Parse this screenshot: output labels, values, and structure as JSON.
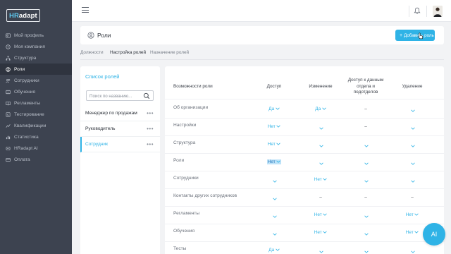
{
  "logo": {
    "text_hr": "HR",
    "text_rest": "adapt"
  },
  "sidebar": {
    "items": [
      {
        "label": "Мой профиль",
        "icon": "profile-icon"
      },
      {
        "label": "Моя компания",
        "icon": "company-icon"
      },
      {
        "label": "Структура",
        "icon": "structure-icon"
      },
      {
        "label": "Роли",
        "icon": "roles-icon",
        "active": true
      },
      {
        "label": "Сотрудники",
        "icon": "employees-icon"
      },
      {
        "label": "Обучения",
        "icon": "training-icon"
      },
      {
        "label": "Регламенты",
        "icon": "regulations-icon"
      },
      {
        "label": "Тестирование",
        "icon": "testing-icon"
      },
      {
        "label": "Квалификации",
        "icon": "qualifications-icon"
      },
      {
        "label": "Статистика",
        "icon": "statistics-icon"
      },
      {
        "label": "HRadapt AI",
        "icon": "ai-icon"
      },
      {
        "label": "Оплата",
        "icon": "payment-icon"
      }
    ]
  },
  "header": {
    "title": "Роли",
    "add_button": "Добавить роль"
  },
  "tabs": [
    {
      "label": "Должности"
    },
    {
      "label": "Настройка ролей",
      "active": true
    },
    {
      "label": "Назначение ролей"
    }
  ],
  "roles_panel": {
    "title": "Список ролей",
    "search_placeholder": "Поиск по названию...",
    "roles": [
      {
        "name": "Менеджер по продажам"
      },
      {
        "name": "Руководитель"
      },
      {
        "name": "Сотрудник",
        "selected": true
      }
    ]
  },
  "permissions": {
    "headers": {
      "capability": "Возможности роли",
      "access": "Доступ",
      "edit": "Изменение",
      "dept_access_l1": "Доступ к данным",
      "dept_access_l2": "отдела и",
      "dept_access_l3": "подотделов",
      "delete": "Удаление"
    },
    "rows": [
      {
        "label": "Об организации",
        "access": "Да",
        "edit": "Да",
        "dept": "–",
        "del": ""
      },
      {
        "label": "Настройки",
        "access": "Нет",
        "edit": "",
        "dept": "–",
        "del": ""
      },
      {
        "label": "Структура",
        "access": "Нет",
        "edit": "",
        "dept": "",
        "del": ""
      },
      {
        "label": "Роли",
        "access": "Нет",
        "edit": "",
        "dept": "",
        "del": ""
      },
      {
        "label": "Сотрудники",
        "access": "",
        "edit": "Нет",
        "dept": "",
        "del": ""
      },
      {
        "label": "Контакты других сотрудников",
        "access": "",
        "edit": "–",
        "dept": "–",
        "del": "–"
      },
      {
        "label": "Регламенты",
        "access": "",
        "edit": "Нет",
        "dept": "",
        "del": "Нет"
      },
      {
        "label": "Обучения",
        "access": "",
        "edit": "Нет",
        "dept": "",
        "del": "Нет"
      },
      {
        "label": "Тесты",
        "access": "Да",
        "edit": "",
        "dept": "",
        "del": ""
      }
    ]
  },
  "ai_button": "AI",
  "colors": {
    "accent": "#2fb3e6",
    "sidebar_bg": "#3d4350",
    "sidebar_active": "#2f343f"
  }
}
